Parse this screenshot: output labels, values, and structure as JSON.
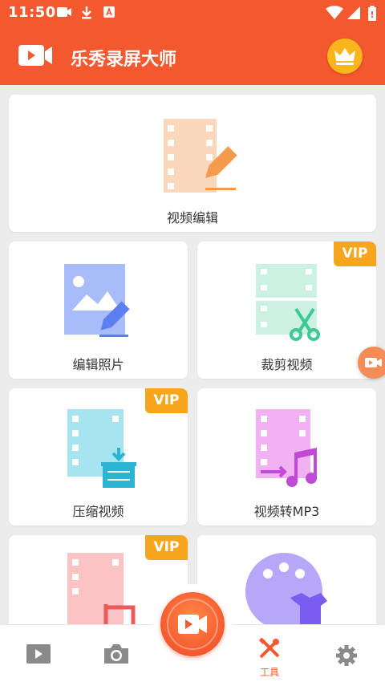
{
  "status_bar": {
    "time": "11:50"
  },
  "app_bar": {
    "title": "乐秀录屏大师"
  },
  "cards": {
    "video_edit": {
      "label": "视频编辑"
    },
    "photo_edit": {
      "label": "编辑照片"
    },
    "trim_video": {
      "label": "裁剪视频",
      "badge": "VIP"
    },
    "compress_video": {
      "label": "压缩视频",
      "badge": "VIP"
    },
    "video_to_mp3": {
      "label": "视频转MP3"
    },
    "crop_video": {
      "badge": "VIP"
    }
  },
  "bottom_nav": {
    "tools_label": "工具"
  },
  "colors": {
    "accent": "#f4582e",
    "vip": "#f7a51c",
    "crown": "#fbb51c"
  }
}
